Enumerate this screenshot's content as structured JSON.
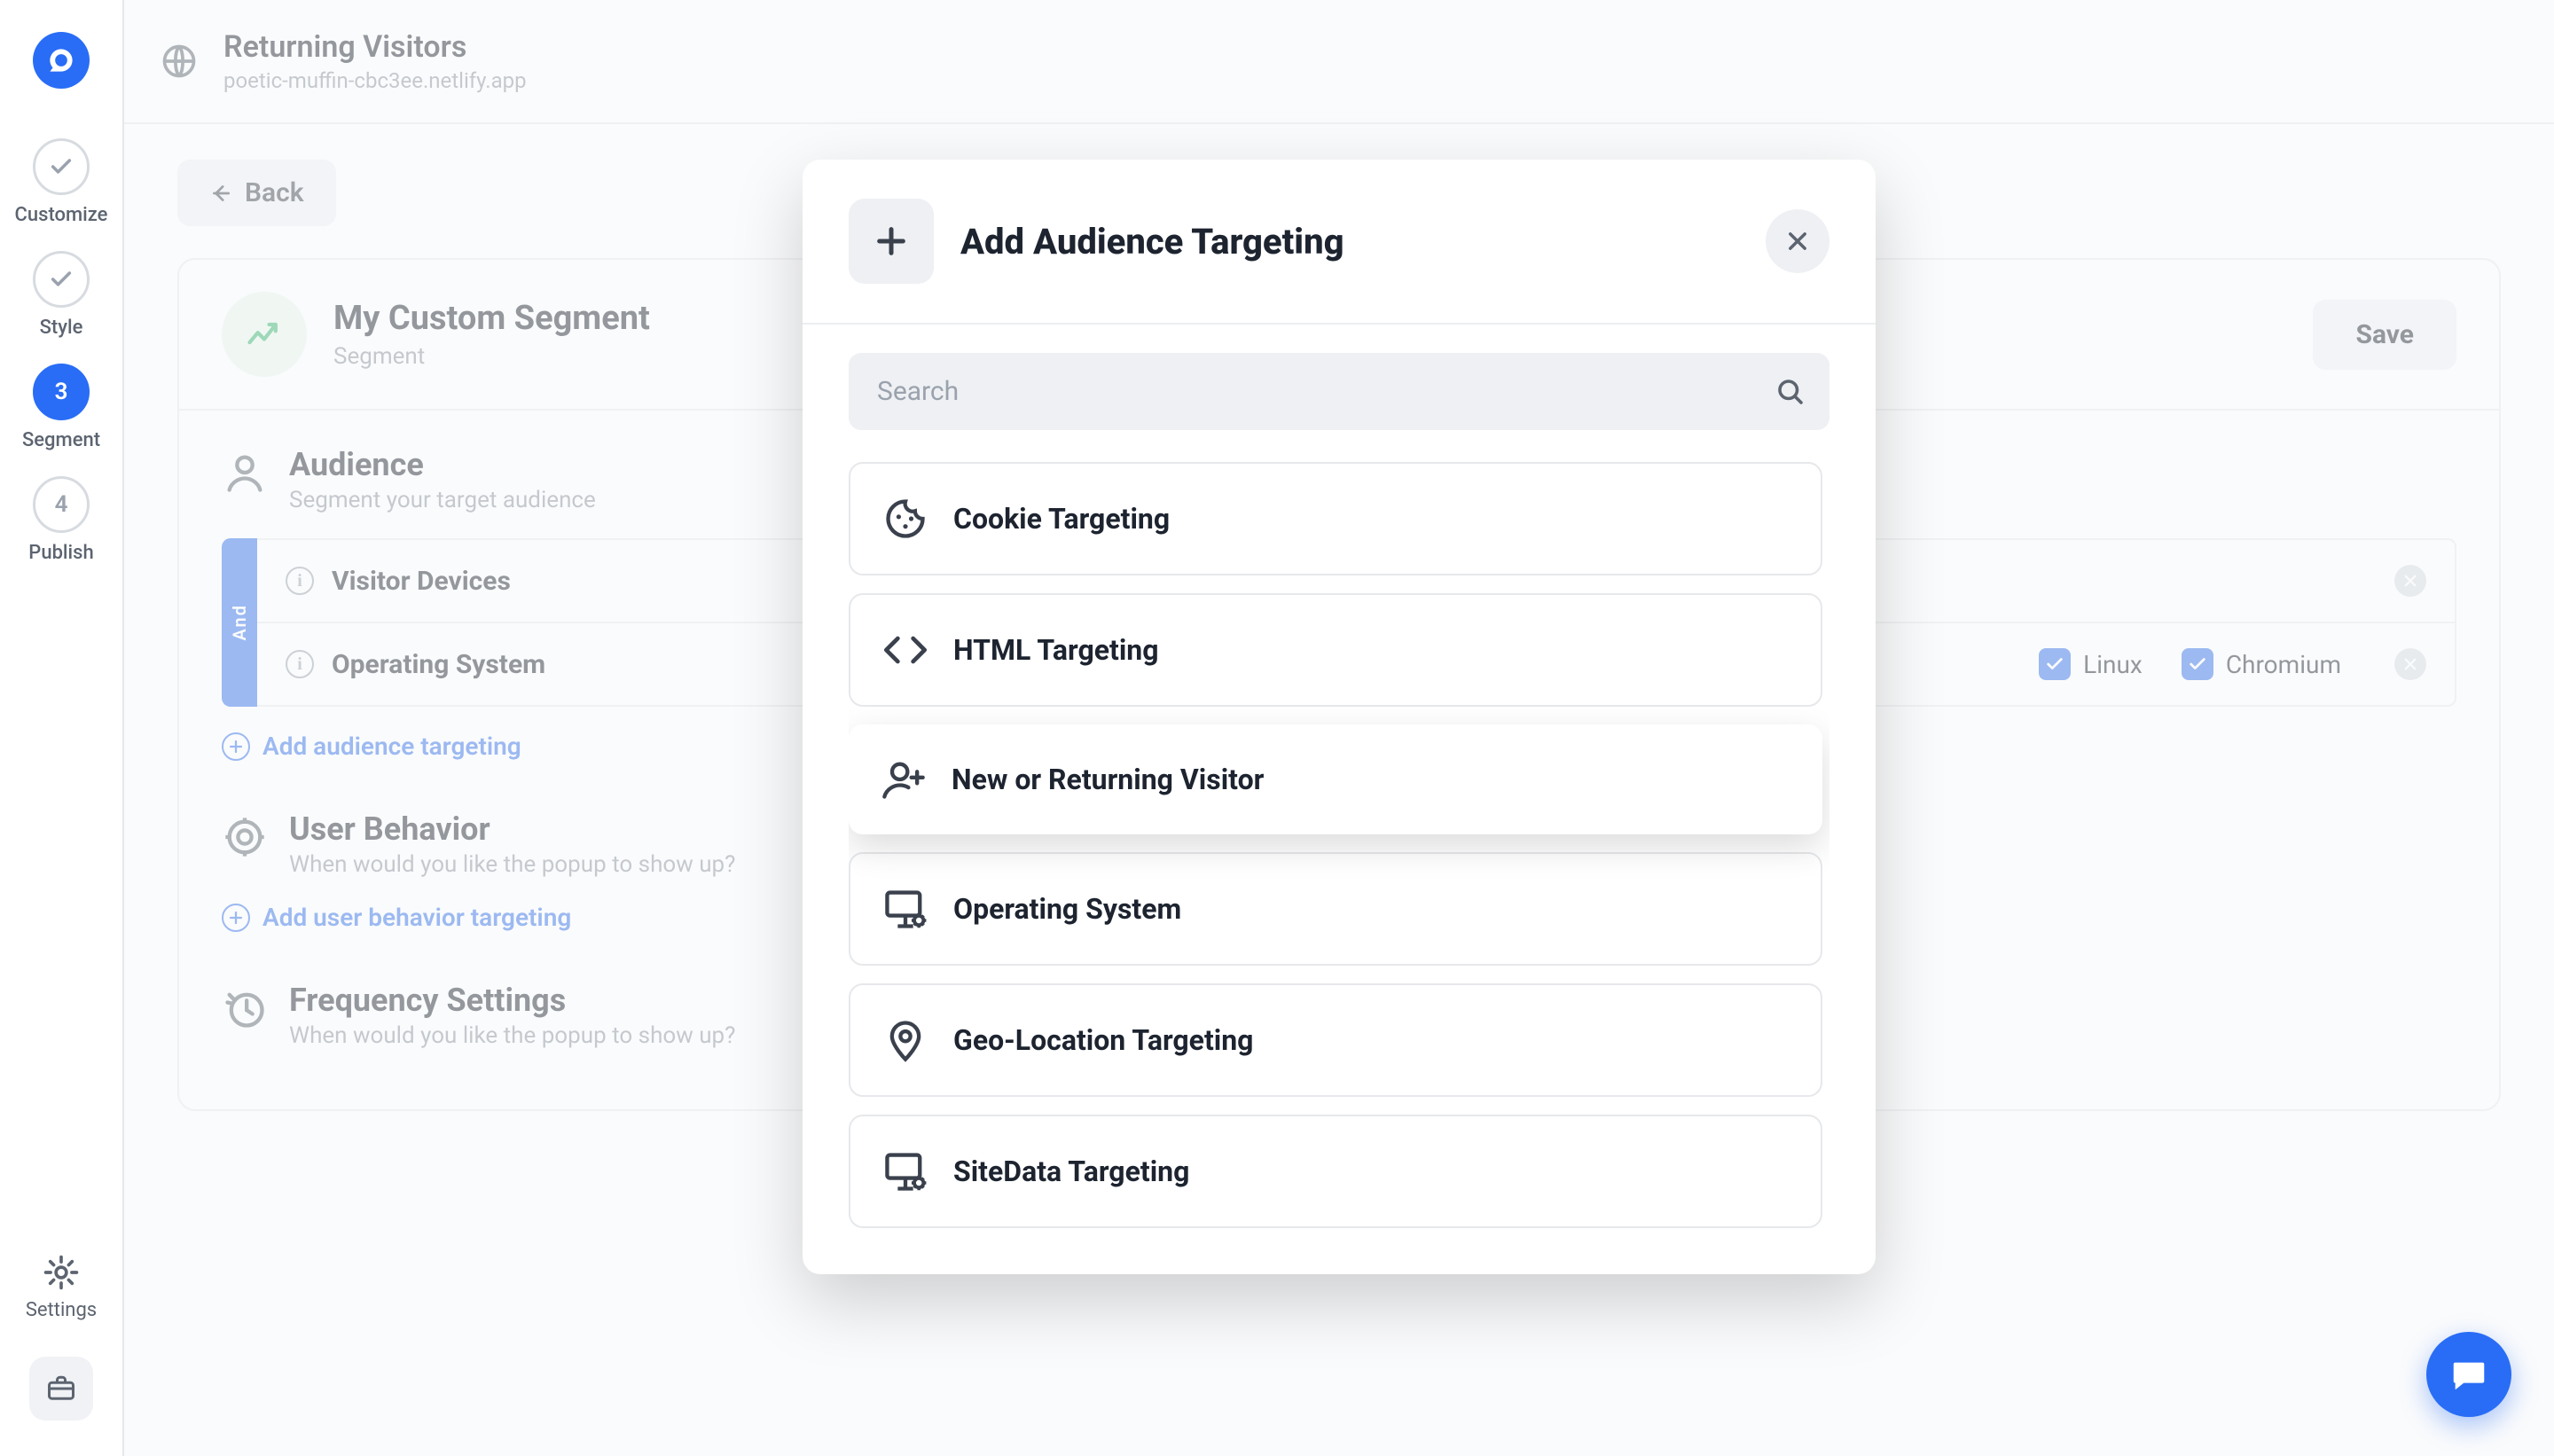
{
  "colors": {
    "accent": "#296df6",
    "success": "#29b765"
  },
  "sidebar": {
    "steps": [
      {
        "label": "Customize",
        "done": true
      },
      {
        "label": "Style",
        "done": true
      },
      {
        "label": "Segment",
        "number": "3",
        "active": true
      },
      {
        "label": "Publish",
        "number": "4"
      }
    ],
    "settings_label": "Settings"
  },
  "topbar": {
    "title": "Returning Visitors",
    "subtitle": "poetic-muffin-cbc3ee.netlify.app"
  },
  "back_label": "Back",
  "segment": {
    "title": "My Custom Segment",
    "subtitle": "Segment",
    "save_label": "Save"
  },
  "audience": {
    "title": "Audience",
    "subtitle": "Segment your target audience",
    "group_operator": "And",
    "rules": [
      {
        "name": "Visitor Devices",
        "checks": []
      },
      {
        "name": "Operating System",
        "checks": [
          "Linux",
          "Chromium"
        ]
      }
    ],
    "add_label": "Add audience targeting"
  },
  "user_behavior": {
    "title": "User Behavior",
    "subtitle": "When would you like the popup to show up?",
    "add_label": "Add user behavior targeting"
  },
  "frequency": {
    "title": "Frequency Settings",
    "subtitle": "When would you like the popup to show up?"
  },
  "modal": {
    "title": "Add Audience Targeting",
    "search_placeholder": "Search",
    "options": [
      {
        "label": "Cookie Targeting",
        "icon": "cookie"
      },
      {
        "label": "HTML Targeting",
        "icon": "code"
      },
      {
        "label": "New or Returning Visitor",
        "icon": "user-plus",
        "highlight": true
      },
      {
        "label": "Operating System",
        "icon": "desktop-cog"
      },
      {
        "label": "Geo-Location Targeting",
        "icon": "pin"
      },
      {
        "label": "SiteData Targeting",
        "icon": "desktop-cog"
      }
    ]
  }
}
